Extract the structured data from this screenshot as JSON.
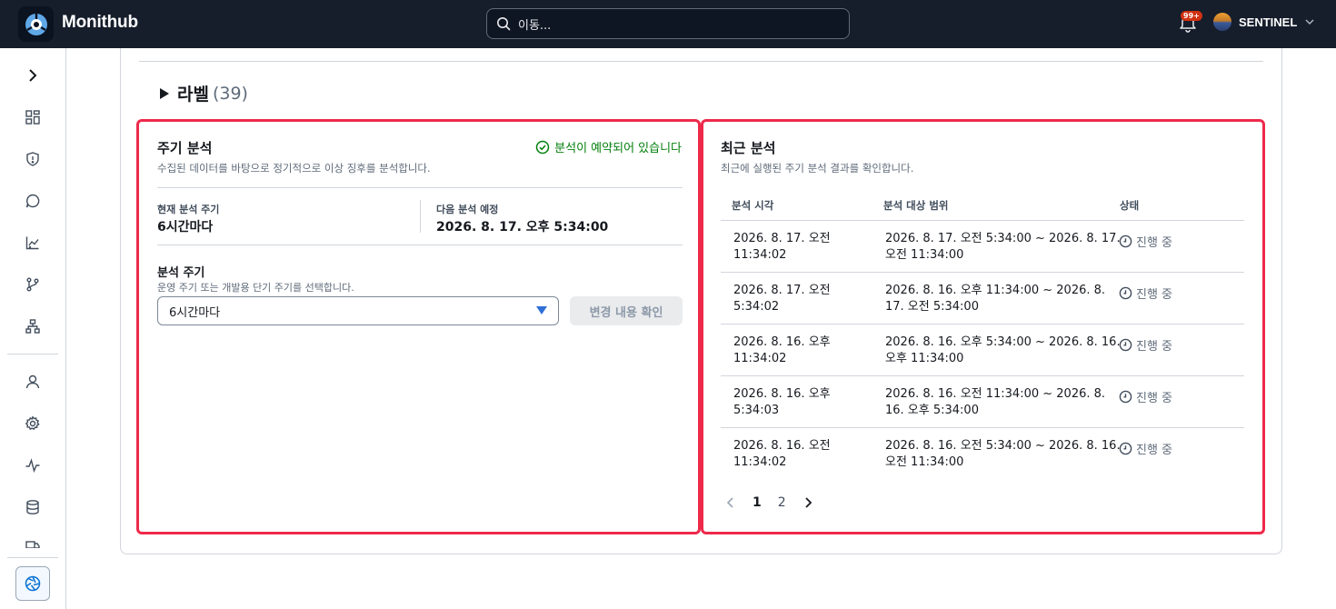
{
  "header": {
    "brand": "Monithub",
    "search_placeholder": "이동...",
    "notification_badge": "99+",
    "user_name": "SENTINEL"
  },
  "labels_section": {
    "title": "라벨",
    "count": "(39)"
  },
  "periodic": {
    "title": "주기 분석",
    "description": "수집된 데이터를 바탕으로 정기적으로 이상 징후를 분석합니다.",
    "status": "분석이 예약되어 있습니다",
    "current_label": "현재 분석 주기",
    "current_value": "6시간마다",
    "next_label": "다음 분석 예정",
    "next_value": "2026. 8. 17. 오후 5:34:00",
    "field_label": "분석 주기",
    "field_desc": "운영 주기 또는 개발용 단기 주기를 선택합니다.",
    "select_value": "6시간마다",
    "confirm_button": "변경 내용 확인"
  },
  "recent": {
    "title": "최근 분석",
    "description": "최근에 실행된 주기 분석 결과를 확인합니다.",
    "columns": [
      "분석 시각",
      "분석 대상 범위",
      "상태"
    ],
    "rows": [
      {
        "time1": "2026. 8. 17. 오전",
        "time2": "11:34:02",
        "range1": "2026. 8. 17. 오전 5:34:00 ~ 2026. 8. 17.",
        "range2": "오전 11:34:00",
        "status": "진행 중"
      },
      {
        "time1": "2026. 8. 17. 오전",
        "time2": "5:34:02",
        "range1": "2026. 8. 16. 오후 11:34:00 ~ 2026. 8.",
        "range2": "17. 오전 5:34:00",
        "status": "진행 중"
      },
      {
        "time1": "2026. 8. 16. 오후",
        "time2": "11:34:02",
        "range1": "2026. 8. 16. 오후 5:34:00 ~ 2026. 8. 16.",
        "range2": "오후 11:34:00",
        "status": "진행 중"
      },
      {
        "time1": "2026. 8. 16. 오후",
        "time2": "5:34:03",
        "range1": "2026. 8. 16. 오전 11:34:00 ~ 2026. 8.",
        "range2": "16. 오후 5:34:00",
        "status": "진행 중"
      },
      {
        "time1": "2026. 8. 16. 오전",
        "time2": "11:34:02",
        "range1": "2026. 8. 16. 오전 5:34:00 ~ 2026. 8. 16.",
        "range2": "오전 11:34:00",
        "status": "진행 중"
      }
    ],
    "pages": [
      "1",
      "2"
    ]
  },
  "colors": {
    "accent": "#2f6fd6",
    "success": "#037f0c",
    "highlight": "#ee2a4b",
    "topbar": "#161d2b"
  }
}
